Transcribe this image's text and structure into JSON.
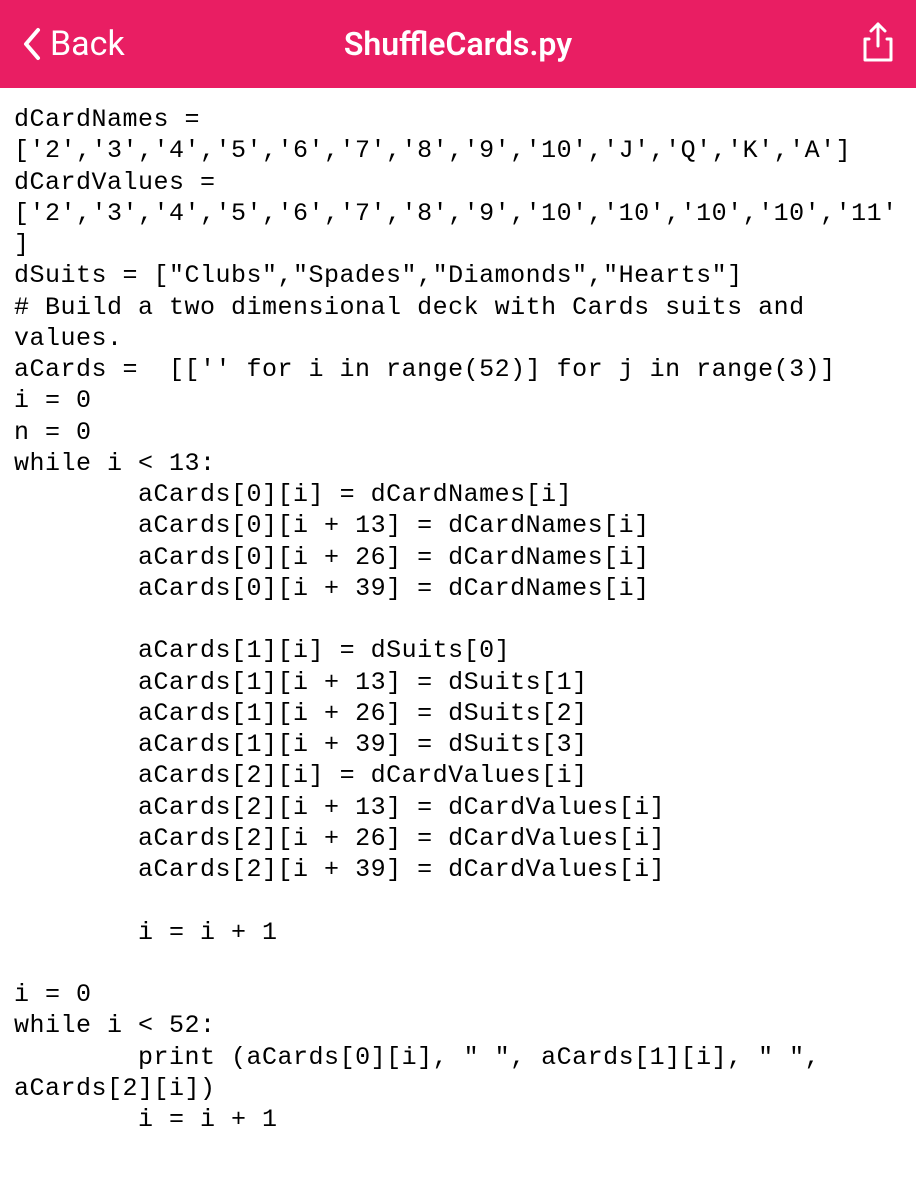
{
  "header": {
    "back_label": "Back",
    "title": "ShuffleCards.py"
  },
  "code": "dCardNames =\n['2','3','4','5','6','7','8','9','10','J','Q','K','A']\ndCardValues =\n['2','3','4','5','6','7','8','9','10','10','10','10','11']\ndSuits = [\"Clubs\",\"Spades\",\"Diamonds\",\"Hearts\"]\n# Build a two dimensional deck with Cards suits and values.\naCards =  [['' for i in range(52)] for j in range(3)]\ni = 0\nn = 0\nwhile i < 13:\n        aCards[0][i] = dCardNames[i]\n        aCards[0][i + 13] = dCardNames[i]\n        aCards[0][i + 26] = dCardNames[i]\n        aCards[0][i + 39] = dCardNames[i]\n\n        aCards[1][i] = dSuits[0]\n        aCards[1][i + 13] = dSuits[1]\n        aCards[1][i + 26] = dSuits[2]\n        aCards[1][i + 39] = dSuits[3]\n        aCards[2][i] = dCardValues[i]\n        aCards[2][i + 13] = dCardValues[i]\n        aCards[2][i + 26] = dCardValues[i]\n        aCards[2][i + 39] = dCardValues[i]\n\n        i = i + 1\n\ni = 0\nwhile i < 52:\n        print (aCards[0][i], \" \", aCards[1][i], \" \", aCards[2][i])\n        i = i + 1"
}
